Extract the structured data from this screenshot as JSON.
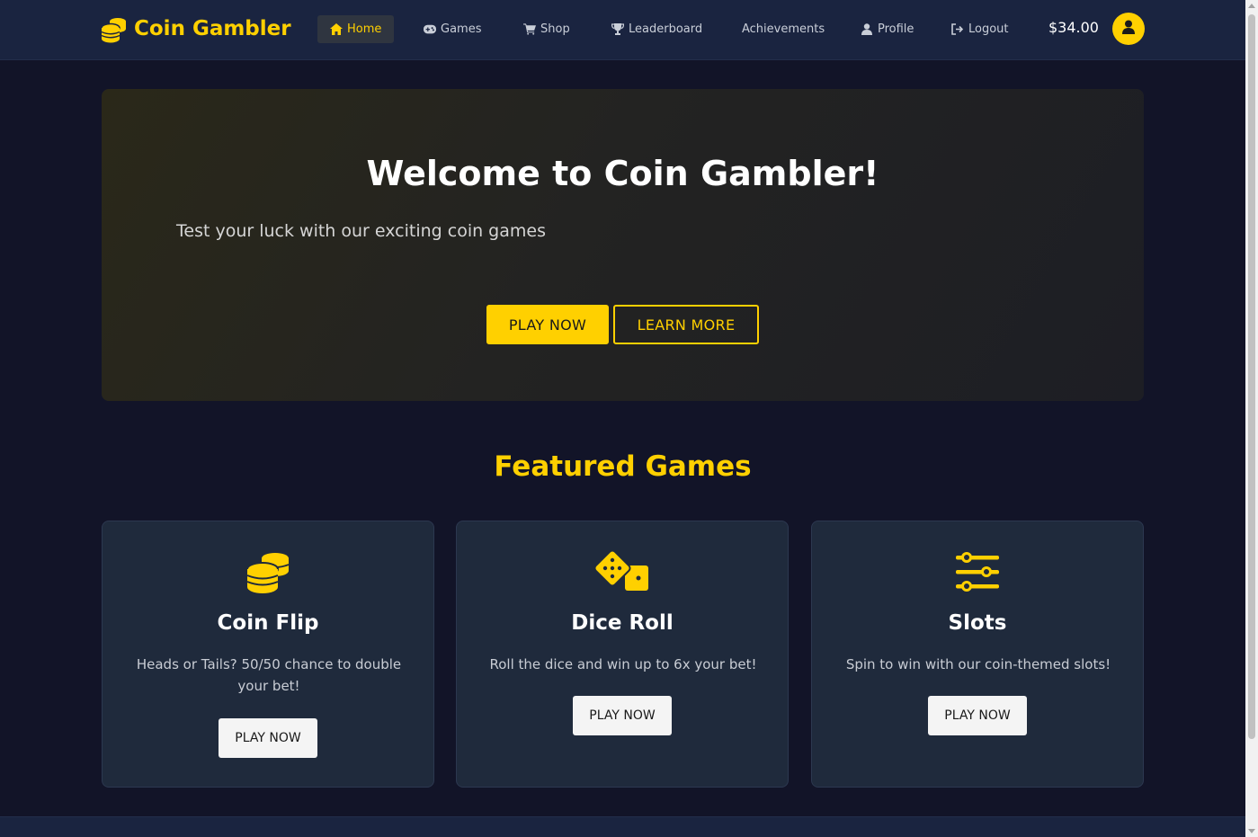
{
  "nav": {
    "brand": "Coin Gambler",
    "items": [
      {
        "label": "Home",
        "icon": "home-icon",
        "active": true
      },
      {
        "label": "Games",
        "icon": "gamepad-icon"
      },
      {
        "label": "Shop",
        "icon": "cart-icon"
      },
      {
        "label": "Leaderboard",
        "icon": "trophy-icon"
      },
      {
        "label": "Achievements",
        "icon": ""
      },
      {
        "label": "Profile",
        "icon": "user-icon"
      },
      {
        "label": "Logout",
        "icon": "logout-icon"
      }
    ],
    "balance": "$34.00"
  },
  "hero": {
    "title": "Welcome to Coin Gambler!",
    "subtitle": "Test your luck with our exciting coin games",
    "primary_btn": "PLAY NOW",
    "secondary_btn": "LEARN MORE"
  },
  "featured": {
    "title": "Featured Games",
    "games": [
      {
        "title": "Coin Flip",
        "desc": "Heads or Tails? 50/50 chance to double your bet!",
        "btn": "PLAY NOW",
        "icon": "coins-icon"
      },
      {
        "title": "Dice Roll",
        "desc": "Roll the dice and win up to 6x your bet!",
        "btn": "PLAY NOW",
        "icon": "dice-icon"
      },
      {
        "title": "Slots",
        "desc": "Spin to win with our coin-themed slots!",
        "btn": "PLAY NOW",
        "icon": "sliders-icon"
      }
    ]
  },
  "colors": {
    "accent": "#ffd000",
    "navbar": "#1a2440",
    "background": "#121428",
    "card": "#1f2a3c"
  }
}
